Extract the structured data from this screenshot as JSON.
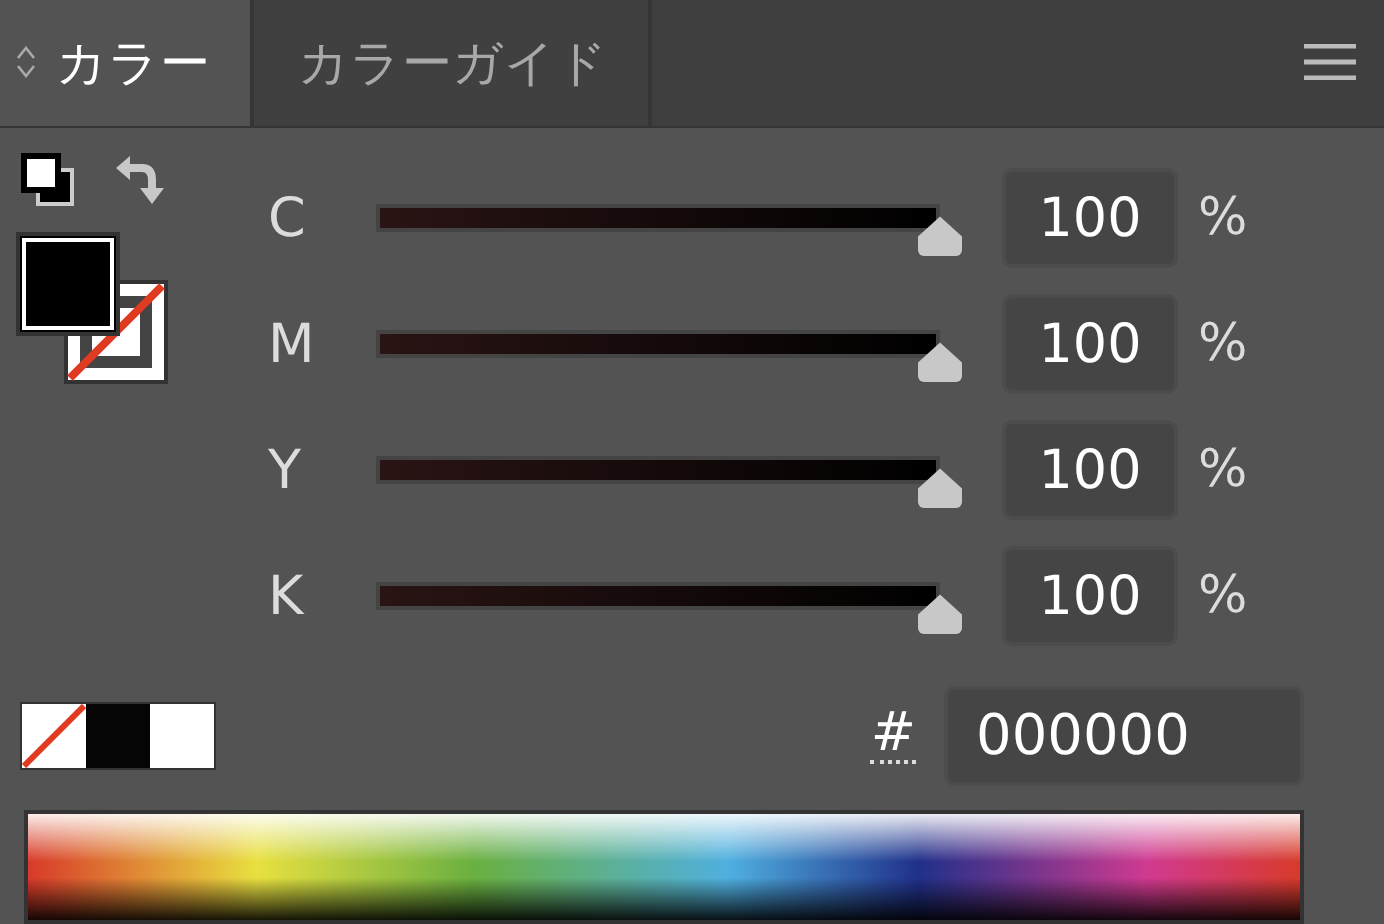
{
  "tabs": [
    {
      "label": "カラー",
      "selected": true
    },
    {
      "label": "カラーガイド",
      "selected": false
    }
  ],
  "channels": [
    {
      "name": "C",
      "level": 1,
      "value": "100",
      "unit": "%"
    },
    {
      "name": "M",
      "level": 1,
      "value": "100",
      "unit": "%"
    },
    {
      "name": "Y",
      "level": 1,
      "value": "100",
      "unit": "%"
    },
    {
      "name": "K",
      "level": 1,
      "value": "100",
      "unit": "%"
    }
  ],
  "hex": {
    "label": "#",
    "value": "000000"
  }
}
